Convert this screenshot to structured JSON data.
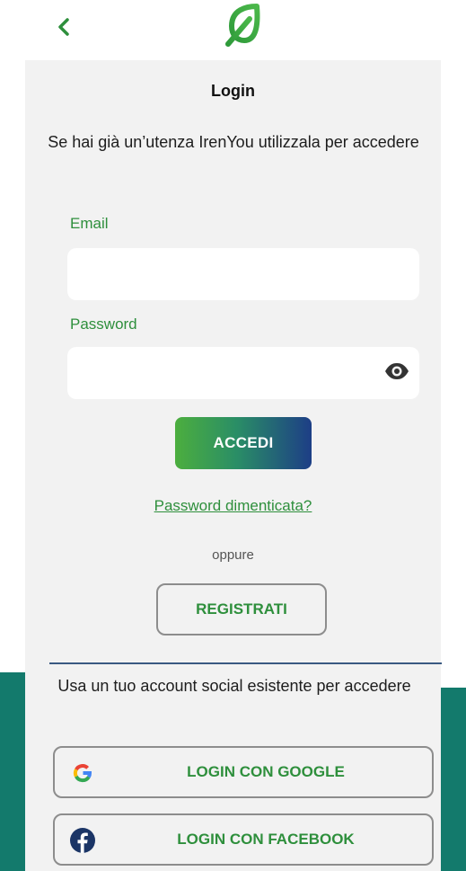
{
  "header": {
    "back_icon": "chevron-left-icon",
    "logo_icon": "leaf-logo-icon"
  },
  "login": {
    "title": "Login",
    "subtitle": "Se hai già un’utenza IrenYou utilizzala per accedere",
    "email_label": "Email",
    "email_value": "",
    "password_label": "Password",
    "password_value": "",
    "show_password_icon": "eye-icon",
    "submit_label": "ACCEDI",
    "forgot_link": "Password dimenticata?",
    "or_text": "oppure",
    "register_label": "REGISTRATI"
  },
  "social": {
    "intro": "Usa un tuo account social esistente per accedere",
    "google_label": "LOGIN CON GOOGLE",
    "google_icon": "google-icon",
    "facebook_label": "LOGIN CON FACEBOOK",
    "facebook_icon": "facebook-icon"
  },
  "colors": {
    "accent_green": "#2e8f3c",
    "teal_background": "#137a6c",
    "card_background": "#f2f2f2",
    "button_gradient_start": "#4cae3e",
    "button_gradient_end": "#1d3e86"
  }
}
